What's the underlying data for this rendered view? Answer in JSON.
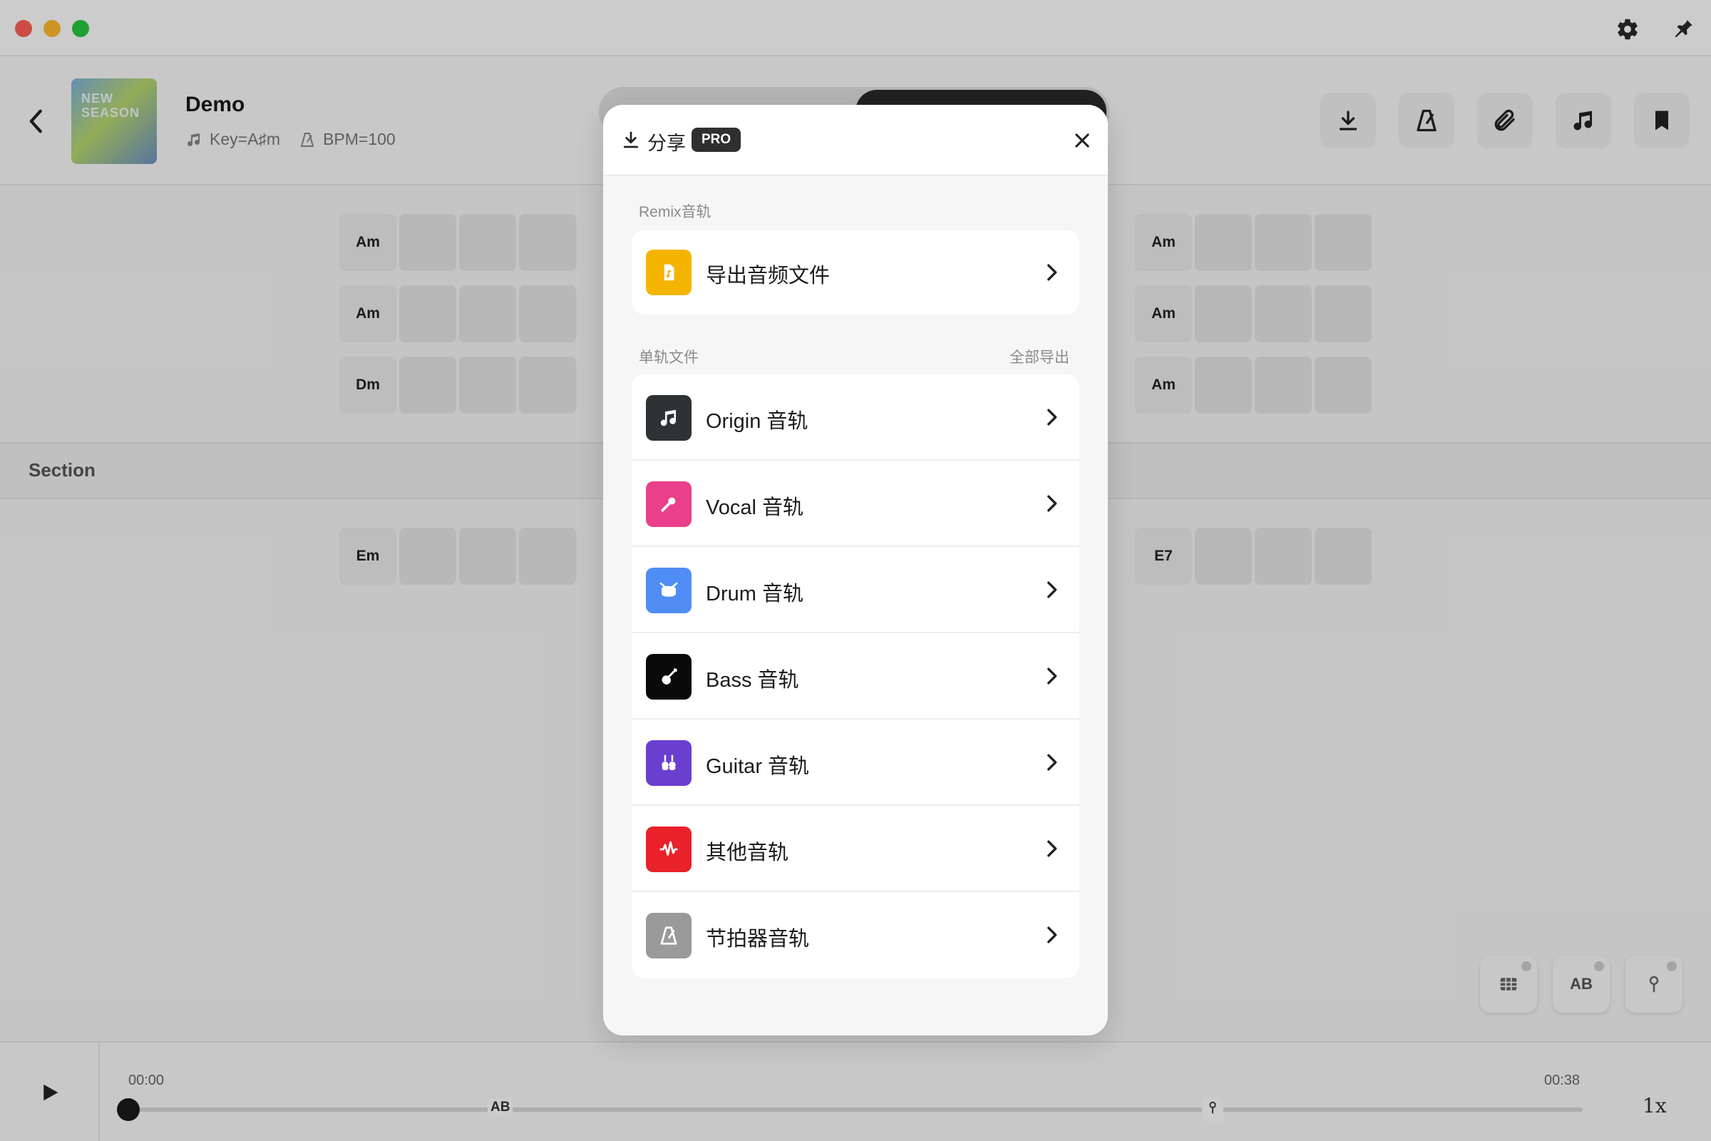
{
  "window": {
    "title_icons": [
      "gear-icon",
      "pin-icon"
    ]
  },
  "header": {
    "song_title": "Demo",
    "cover_text": "NEW SEASON",
    "key": "Key=A♯m",
    "bpm": "BPM=100",
    "tools": [
      "download-icon",
      "metronome-icon",
      "attachment-icon",
      "music-note-icon",
      "bookmark-icon"
    ]
  },
  "grid": {
    "left_rows": [
      {
        "chord": "Am"
      },
      {
        "chord": "Am"
      },
      {
        "chord": "Dm"
      }
    ],
    "right_rows": [
      {
        "chord": "Am"
      },
      {
        "chord": "Am"
      },
      {
        "chord": "Am"
      }
    ],
    "section_label": "Section",
    "section_left": {
      "chord": "Em"
    },
    "section_right": {
      "chord": "E7"
    }
  },
  "floating_buttons": {
    "ab_label": "AB"
  },
  "player": {
    "time_start": "00:00",
    "time_end": "00:38",
    "ab_marker": "AB",
    "speed": "1x",
    "progress_fraction": 0.0
  },
  "modal": {
    "title": "分享",
    "pro_badge": "PRO",
    "remix_group_label": "Remix音轨",
    "remix_items": [
      {
        "label": "导出音频文件",
        "icon": "audio-file-icon",
        "color": "#f5b400"
      }
    ],
    "tracks_group_label": "单轨文件",
    "tracks_group_action": "全部导出",
    "track_items": [
      {
        "label": "Origin 音轨",
        "icon": "music-note-icon",
        "color": "#2f3235"
      },
      {
        "label": "Vocal 音轨",
        "icon": "microphone-icon",
        "color": "#ea3f8b"
      },
      {
        "label": "Drum 音轨",
        "icon": "drum-icon",
        "color": "#4f8df5"
      },
      {
        "label": "Bass 音轨",
        "icon": "bass-guitar-icon",
        "color": "#0a0a0a"
      },
      {
        "label": "Guitar 音轨",
        "icon": "guitars-icon",
        "color": "#6a3fd0"
      },
      {
        "label": "其他音轨",
        "icon": "waveform-icon",
        "color": "#e8212a"
      },
      {
        "label": "节拍器音轨",
        "icon": "metronome-icon",
        "color": "#9a9a9a"
      }
    ]
  }
}
